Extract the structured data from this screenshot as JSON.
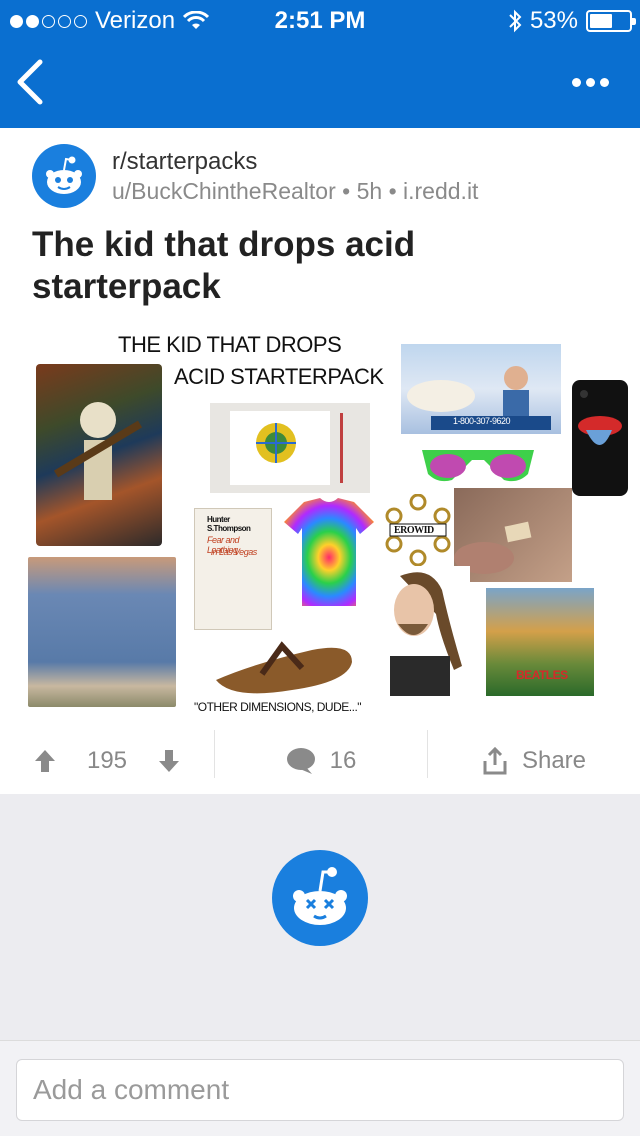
{
  "status_bar": {
    "carrier": "Verizon",
    "time": "2:51 PM",
    "battery": "53%",
    "signal_bars_filled": 2,
    "signal_bars_total": 5,
    "battery_level": 0.53
  },
  "nav": {
    "back_icon": "chevron-left-icon",
    "more_icon": "ellipsis-icon"
  },
  "post": {
    "subreddit": "r/starterpacks",
    "author": "u/BuckChintheRealtor",
    "age": "5h",
    "domain": "i.redd.it",
    "separator": "•",
    "title": "The kid that drops acid starterpack",
    "image": {
      "caption_top_1": "THE KID THAT DROPS",
      "caption_top_2": "ACID STARTERPACK",
      "caption_bottom": "\"OTHER DIMENSIONS, DUDE...\"",
      "book_author": "Hunter S.Thompson",
      "book_title_1": "Fear and Loathing",
      "book_title_2": "in Las Vegas",
      "erowid": "EROWID",
      "phone_number": "1-800-307-9620",
      "beatles": "BEATLES"
    },
    "votes": "195",
    "comments": "16",
    "share_label": "Share"
  },
  "comment": {
    "placeholder": "Add a comment"
  },
  "colors": {
    "brand_blue": "#0a6fd0",
    "snoo_blue": "#1a7fde"
  }
}
